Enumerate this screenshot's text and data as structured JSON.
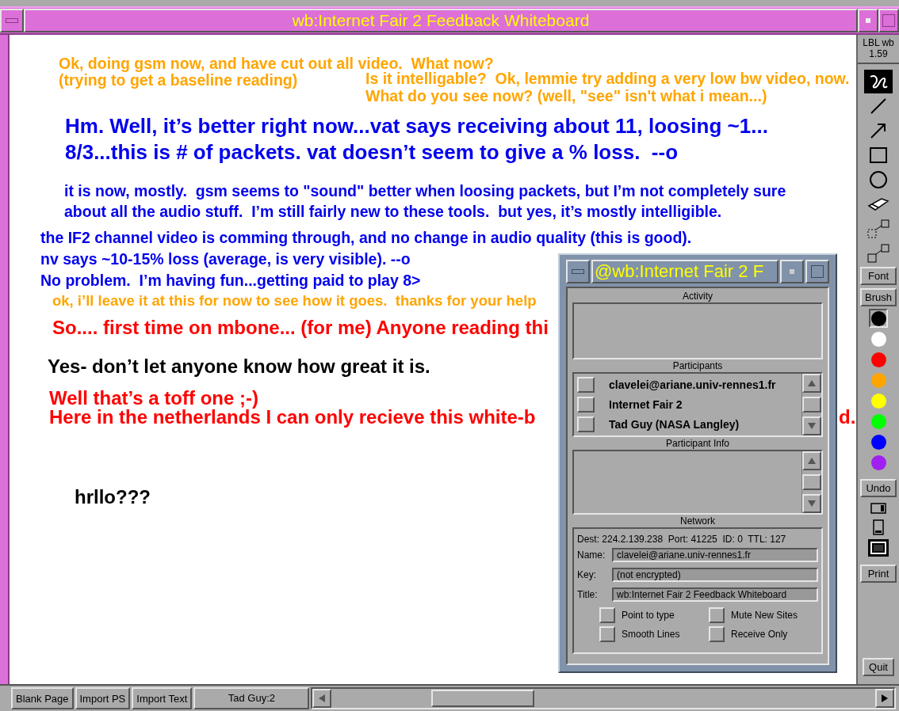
{
  "window": {
    "title": "wb:Internet Fair 2 Feedback Whiteboard"
  },
  "canvas": {
    "notes": [
      {
        "kind": "small",
        "color": "#ffa500",
        "lines": [
          "Ok, doing gsm now, and have cut out all video.  What now?",
          "(trying to get a baseline reading)"
        ]
      },
      {
        "kind": "small",
        "color": "#ffa500",
        "lines": [
          "Is it intelligable?  Ok, lemmie try adding a very low bw video, now.",
          "What do you see now? (well, \"see\" isn't what i mean...)"
        ]
      },
      {
        "kind": "large",
        "color": "#0000ee",
        "lines": [
          "Hm. Well, it’s better right now...vat says receiving about 11, loosing ~1...",
          "8/3...this is # of packets. vat doesn’t seem to give a % loss.  --o"
        ]
      },
      {
        "kind": "small",
        "color": "#0000ee",
        "lines": [
          "it is now, mostly.  gsm seems to \"sound\" better when loosing packets, but I’m not completely sure",
          "about all the audio stuff.  I’m still fairly new to these tools.  but yes, it’s mostly intelligible."
        ]
      },
      {
        "kind": "small",
        "color": "#0000ee",
        "lines": [
          "the IF2 channel video is comming through, and no change in audio quality (this is good).",
          "nv says ~10-15% loss (average, is very visible). --o",
          "No problem.  I’m having fun...getting paid to play 8>"
        ]
      },
      {
        "kind": "small",
        "color": "#ffa500",
        "lines": [
          "ok, i’ll leave it at this for now to see how it goes.  thanks for your help"
        ]
      },
      {
        "kind": "large",
        "color": "#ff0000",
        "lines": [
          "So.... first time on mbone... (for me) Anyone reading thi"
        ]
      },
      {
        "kind": "large",
        "color": "#000000",
        "lines": [
          "Yes- don’t let anyone know how great it is."
        ]
      },
      {
        "kind": "large",
        "color": "#ff0000",
        "lines": [
          "Well that’s a toff one ;-)",
          "Here in the netherlands I can only recieve this white-b"
        ]
      },
      {
        "kind": "large",
        "color": "#ff0000",
        "lines": [
          "d."
        ]
      },
      {
        "kind": "large",
        "color": "#000000",
        "lines": [
          "hrllo???"
        ]
      }
    ]
  },
  "toolbar": {
    "name": "LBL wb",
    "version": "1.59",
    "tools": [
      {
        "kind": "scribble",
        "selected": true
      },
      {
        "kind": "line",
        "selected": false
      },
      {
        "kind": "arrow",
        "selected": false
      },
      {
        "kind": "rectangle",
        "selected": false
      },
      {
        "kind": "circle",
        "selected": false
      },
      {
        "kind": "eraser",
        "selected": false
      },
      {
        "kind": "copy",
        "selected": false
      },
      {
        "kind": "move",
        "selected": false
      }
    ],
    "font_button": "Font",
    "brush_button": "Brush",
    "colors": [
      {
        "color": "#000000",
        "selected": true
      },
      {
        "color": "#ffffff",
        "selected": false
      },
      {
        "color": "#ff0000",
        "selected": false
      },
      {
        "color": "#ffa500",
        "selected": false
      },
      {
        "color": "#ffff00",
        "selected": false
      },
      {
        "color": "#00ff00",
        "selected": false
      },
      {
        "color": "#0000ff",
        "selected": false
      },
      {
        "color": "#a020f0",
        "selected": false
      }
    ],
    "undo_button": "Undo",
    "page_sizes": [
      {
        "kind": "landscape",
        "selected": false
      },
      {
        "kind": "portrait",
        "selected": false
      },
      {
        "kind": "full",
        "selected": true
      }
    ],
    "print_button": "Print",
    "quit_button": "Quit"
  },
  "bottom_bar": {
    "buttons": [
      "Blank Page",
      "Import PS",
      "Import Text"
    ],
    "page_label": "Tad Guy:2"
  },
  "dialog": {
    "title": "@wb:Internet Fair 2 F",
    "activity_label": "Activity",
    "participants_label": "Participants",
    "participants": [
      "clavelei@ariane.univ-rennes1.fr",
      "Internet Fair 2",
      "Tad Guy (NASA Langley)"
    ],
    "participant_info_label": "Participant Info",
    "network_label": "Network",
    "network_info": "Dest: 224.2.139.238  Port: 41225  ID: 0  TTL: 127",
    "fields": [
      {
        "label": "Name:",
        "value": "clavelei@ariane.univ-rennes1.fr"
      },
      {
        "label": "Key:",
        "value": "(not encrypted)"
      },
      {
        "label": "Title:",
        "value": "wb:Internet Fair 2 Feedback Whiteboard"
      }
    ],
    "options": [
      {
        "label": "Point to type",
        "checked": false
      },
      {
        "label": "Mute New Sites",
        "checked": false
      },
      {
        "label": "Smooth Lines",
        "checked": false
      },
      {
        "label": "Receive Only",
        "checked": false
      }
    ]
  }
}
